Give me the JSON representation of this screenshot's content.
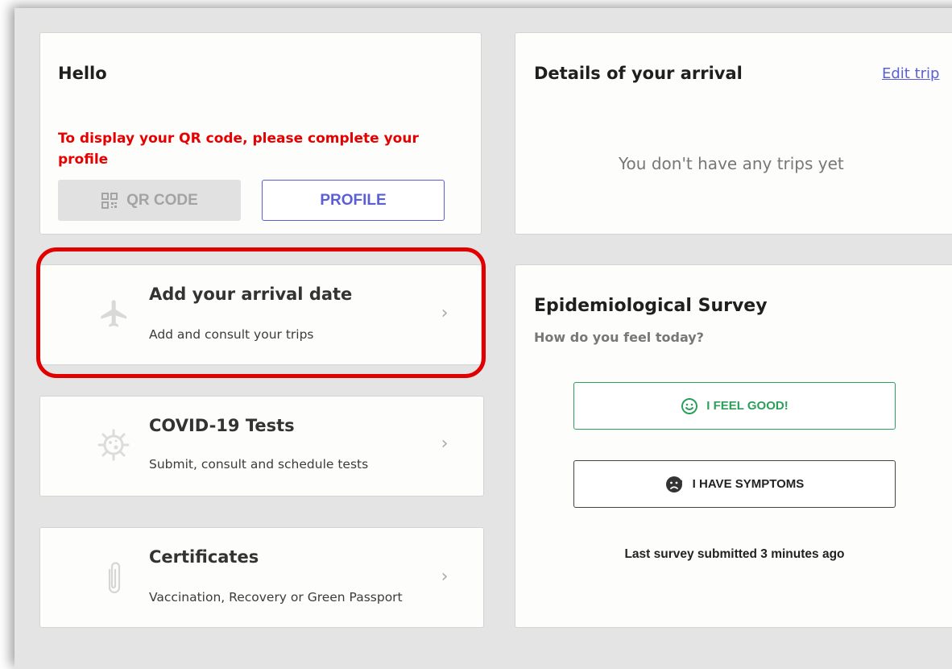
{
  "hello_card": {
    "title": "Hello",
    "warning": "To display your QR code, please complete your profile",
    "qr_button_label": "QR CODE",
    "profile_button_label": "PROFILE"
  },
  "arrival_details": {
    "title": "Details of your arrival",
    "edit_link": "Edit trip",
    "empty_text": "You don't have any trips yet"
  },
  "nav_items": [
    {
      "title": "Add your arrival date",
      "subtitle": "Add and consult your trips",
      "icon": "airplane-icon"
    },
    {
      "title": "COVID-19 Tests",
      "subtitle": "Submit, consult and schedule tests",
      "icon": "virus-icon"
    },
    {
      "title": "Certificates",
      "subtitle": "Vaccination, Recovery or Green Passport",
      "icon": "paperclip-icon"
    }
  ],
  "survey": {
    "title": "Epidemiological Survey",
    "question": "How do you feel today?",
    "good_label": "I FEEL GOOD!",
    "symptoms_label": "I HAVE SYMPTOMS",
    "last_submitted": "Last survey submitted 3 minutes ago"
  },
  "colors": {
    "warning": "#e60000",
    "accent": "#5b5fd6",
    "good": "#2e9e5b",
    "highlight": "#e00000"
  }
}
